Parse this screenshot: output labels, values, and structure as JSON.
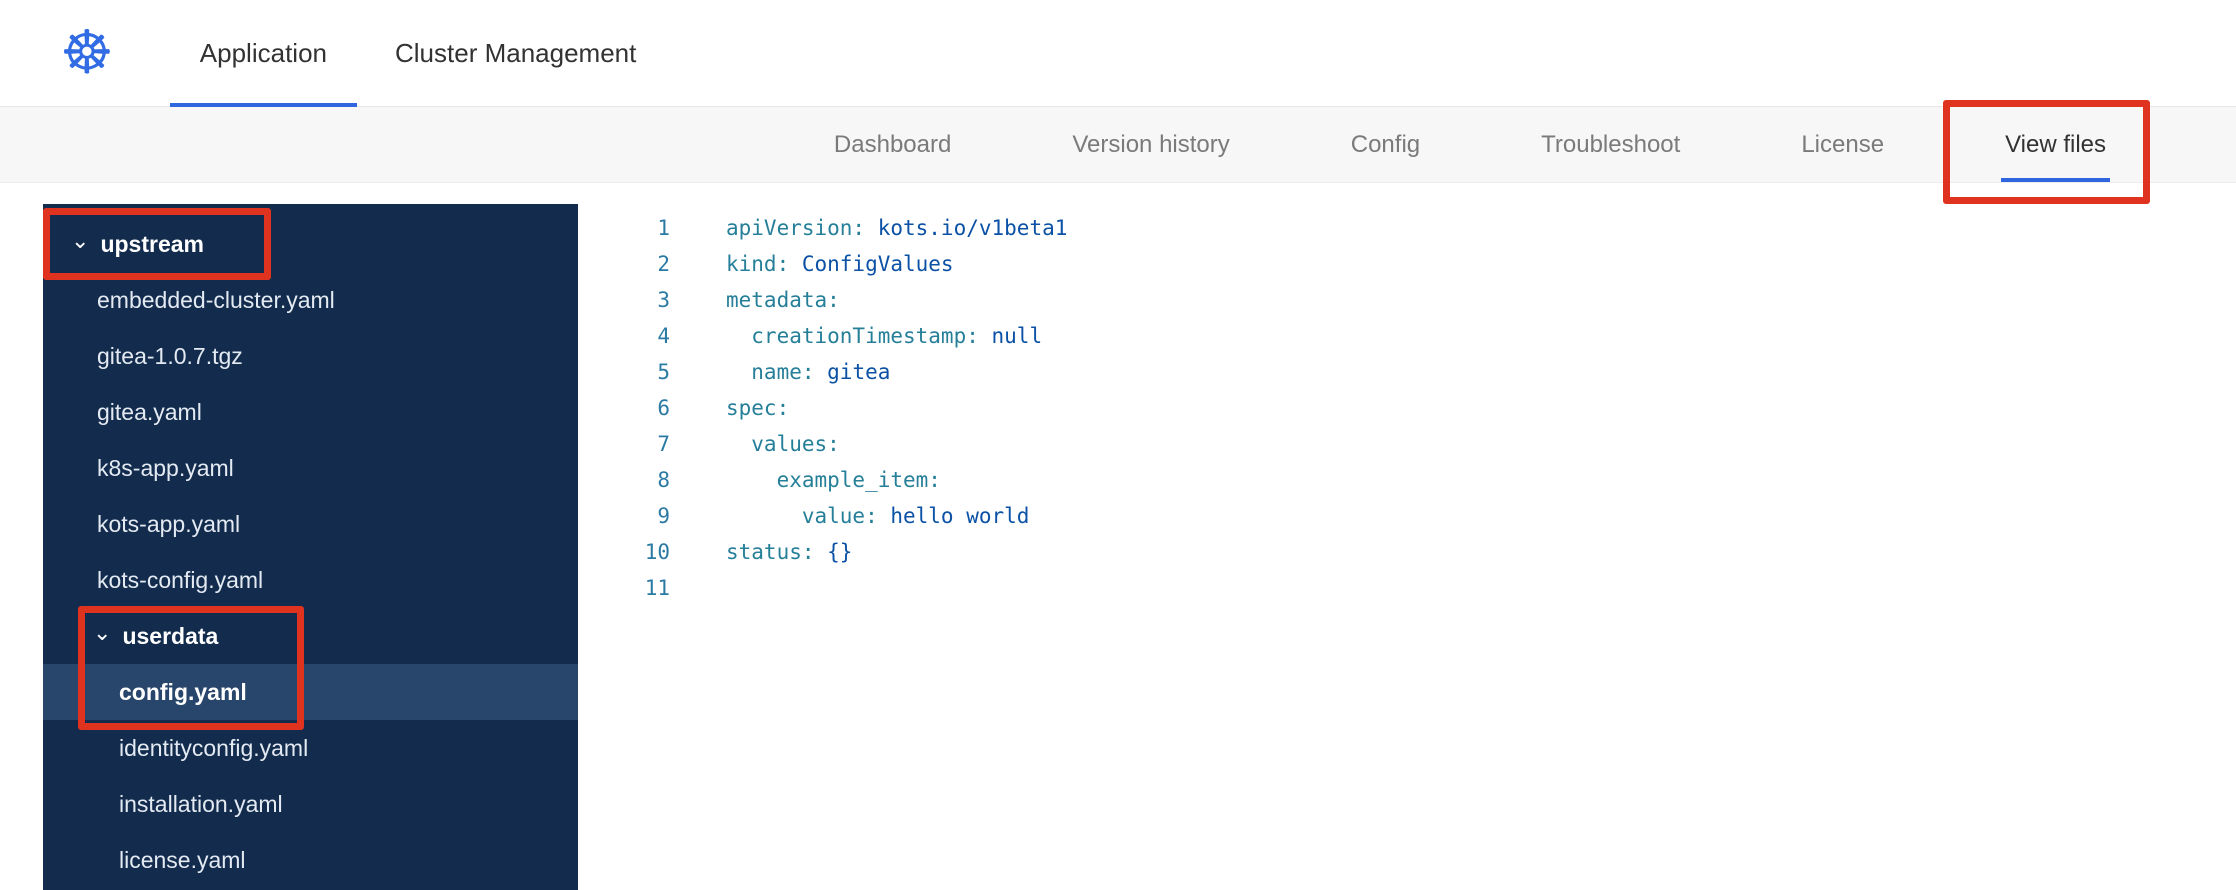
{
  "header": {
    "logo_icon": "kubernetes-logo",
    "tabs": [
      {
        "label": "Application",
        "active": true
      },
      {
        "label": "Cluster Management",
        "active": false
      }
    ]
  },
  "subnav": {
    "tabs": [
      {
        "label": "Dashboard",
        "active": false
      },
      {
        "label": "Version history",
        "active": false
      },
      {
        "label": "Config",
        "active": false
      },
      {
        "label": "Troubleshoot",
        "active": false
      },
      {
        "label": "License",
        "active": false
      },
      {
        "label": "View files",
        "active": true
      }
    ]
  },
  "sidebar": {
    "items": [
      {
        "label": "upstream",
        "type": "folder",
        "depth": 0,
        "expanded": true
      },
      {
        "label": "embedded-cluster.yaml",
        "type": "file",
        "depth": 1
      },
      {
        "label": "gitea-1.0.7.tgz",
        "type": "file",
        "depth": 1
      },
      {
        "label": "gitea.yaml",
        "type": "file",
        "depth": 1
      },
      {
        "label": "k8s-app.yaml",
        "type": "file",
        "depth": 1
      },
      {
        "label": "kots-app.yaml",
        "type": "file",
        "depth": 1
      },
      {
        "label": "kots-config.yaml",
        "type": "file",
        "depth": 1
      },
      {
        "label": "userdata",
        "type": "folder",
        "depth": 1,
        "expanded": true
      },
      {
        "label": "config.yaml",
        "type": "file",
        "depth": 2,
        "selected": true
      },
      {
        "label": "identityconfig.yaml",
        "type": "file",
        "depth": 2
      },
      {
        "label": "installation.yaml",
        "type": "file",
        "depth": 2
      },
      {
        "label": "license.yaml",
        "type": "file",
        "depth": 2
      }
    ]
  },
  "editor": {
    "language": "yaml",
    "lines": [
      {
        "num": "1",
        "key": "apiVersion:",
        "val": " kots.io/v1beta1"
      },
      {
        "num": "2",
        "key": "kind:",
        "val": " ConfigValues"
      },
      {
        "num": "3",
        "key": "metadata:",
        "val": ""
      },
      {
        "num": "4",
        "key": "  creationTimestamp:",
        "val": " null"
      },
      {
        "num": "5",
        "key": "  name:",
        "val": " gitea"
      },
      {
        "num": "6",
        "key": "spec:",
        "val": ""
      },
      {
        "num": "7",
        "key": "  values:",
        "val": ""
      },
      {
        "num": "8",
        "key": "    example_item:",
        "val": ""
      },
      {
        "num": "9",
        "key": "      value:",
        "val": " hello world"
      },
      {
        "num": "10",
        "key": "status:",
        "val": " {}"
      },
      {
        "num": "11",
        "key": "",
        "val": ""
      }
    ]
  },
  "annotations": {
    "color": "#e0331f",
    "boxes": [
      "view-files-tab",
      "upstream-folder",
      "userdata-config-yaml"
    ]
  },
  "colors": {
    "accent_blue": "#326ce5",
    "tab_underline": "#3065e0",
    "annotation_red": "#e0331f",
    "sidebar_bg": "#132b4d",
    "sidebar_selected": "#28466b",
    "code_key": "#267f99",
    "code_value": "#0b51a5",
    "line_number": "#2b7aa3"
  }
}
